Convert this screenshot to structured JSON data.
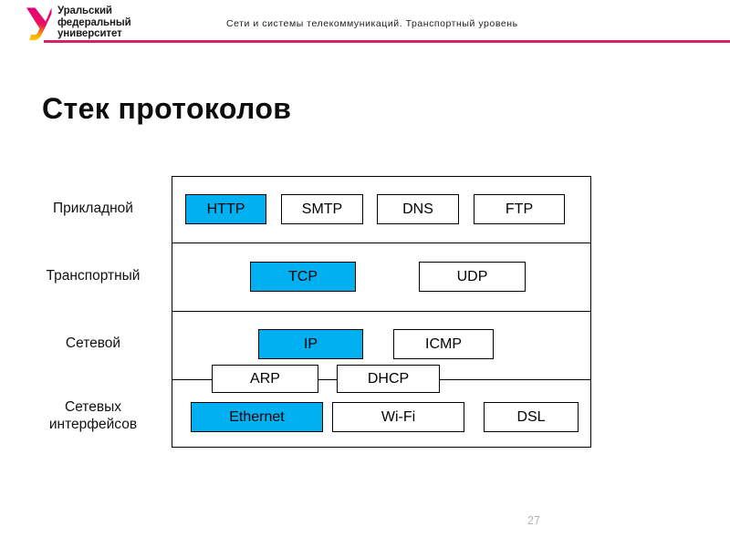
{
  "header": {
    "logo": {
      "icon": "ufu-swoosh-logo",
      "line1": "Уральский",
      "line2": "федеральный",
      "line3": "университет",
      "color_top": "#e4007f",
      "color_bottom": "#ffd200"
    },
    "subtitle": "Сети и системы телекоммуникаций. Транспортный уровень",
    "rule_color": "#d6246a"
  },
  "title": "Стек протоколов",
  "accent_color": "#00b0f0",
  "diagram": {
    "layers": [
      {
        "label": "Прикладной"
      },
      {
        "label": "Транспортный"
      },
      {
        "label": "Сетевой"
      },
      {
        "label": "Сетевых\nинтерфейсов"
      }
    ],
    "layer_labels_flat": [
      "Прикладной",
      "Транспортный",
      "Сетевой",
      "Сетевых",
      "интерфейсов"
    ],
    "protocols": [
      {
        "name": "HTTP",
        "layer": "Прикладной",
        "highlighted": true
      },
      {
        "name": "SMTP",
        "layer": "Прикладной",
        "highlighted": false
      },
      {
        "name": "DNS",
        "layer": "Прикладной",
        "highlighted": false
      },
      {
        "name": "FTP",
        "layer": "Прикладной",
        "highlighted": false
      },
      {
        "name": "TCP",
        "layer": "Транспортный",
        "highlighted": true
      },
      {
        "name": "UDP",
        "layer": "Транспортный",
        "highlighted": false
      },
      {
        "name": "IP",
        "layer": "Сетевой",
        "highlighted": true
      },
      {
        "name": "ICMP",
        "layer": "Сетевой",
        "highlighted": false
      },
      {
        "name": "ARP",
        "layer": "Сетевой/Сетевых интерфейсов",
        "highlighted": false
      },
      {
        "name": "DHCP",
        "layer": "Сетевой/Сетевых интерфейсов",
        "highlighted": false
      },
      {
        "name": "Ethernet",
        "layer": "Сетевых интерфейсов",
        "highlighted": true
      },
      {
        "name": "Wi-Fi",
        "layer": "Сетевых интерфейсов",
        "highlighted": false
      },
      {
        "name": "DSL",
        "layer": "Сетевых интерфейсов",
        "highlighted": false
      }
    ]
  },
  "footer": {
    "page_number": "27"
  }
}
